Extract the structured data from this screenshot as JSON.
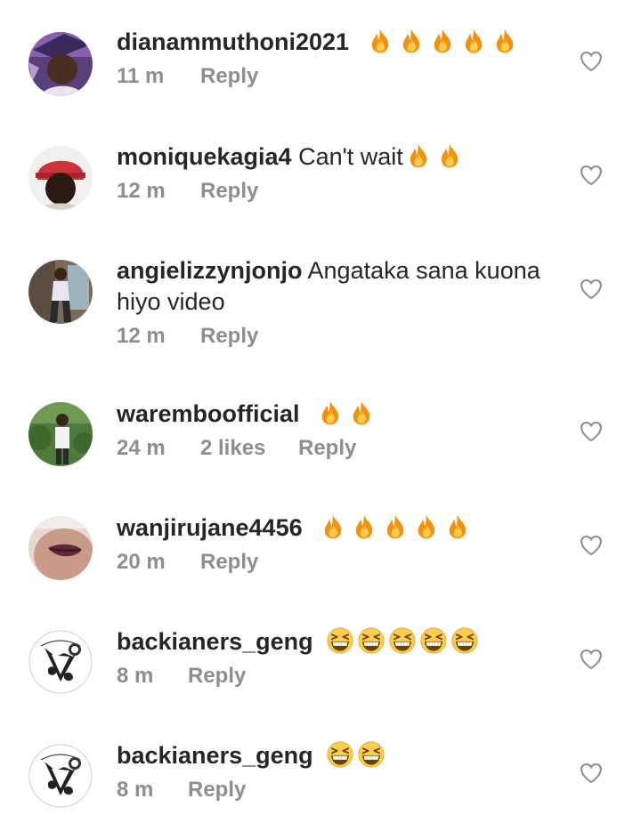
{
  "comments": [
    {
      "username": "dianammuthoni2021",
      "text": "",
      "emoji": "fire-icon",
      "emoji_count": 5,
      "time": "11 m",
      "likes": "",
      "reply": "Reply"
    },
    {
      "username": "moniquekagia4",
      "text": "Can't wait",
      "emoji": "fire-icon",
      "emoji_count": 2,
      "time": "12 m",
      "likes": "",
      "reply": "Reply"
    },
    {
      "username": "angielizzynjonjo",
      "text": "Angataka sana kuona hiyo video",
      "emoji": "",
      "emoji_count": 0,
      "time": "12 m",
      "likes": "",
      "reply": "Reply"
    },
    {
      "username": "waremboofficial",
      "text": "",
      "emoji": "fire-icon",
      "emoji_count": 2,
      "time": "24 m",
      "likes": "2 likes",
      "reply": "Reply"
    },
    {
      "username": "wanjirujane4456",
      "text": "",
      "emoji": "fire-icon",
      "emoji_count": 5,
      "time": "20 m",
      "likes": "",
      "reply": "Reply"
    },
    {
      "username": "backianers_geng",
      "text": "",
      "emoji": "grinning-squinting-face-icon",
      "emoji_count": 5,
      "time": "8 m",
      "likes": "",
      "reply": "Reply"
    },
    {
      "username": "backianers_geng",
      "text": "",
      "emoji": "grinning-squinting-face-icon",
      "emoji_count": 2,
      "time": "8 m",
      "likes": "",
      "reply": "Reply"
    }
  ],
  "colors": {
    "text": "#262626",
    "meta": "#8e8e8e",
    "fire_outer": "#f4900c",
    "fire_inner": "#ffcc4d",
    "laugh_face": "#ffcc4d"
  }
}
